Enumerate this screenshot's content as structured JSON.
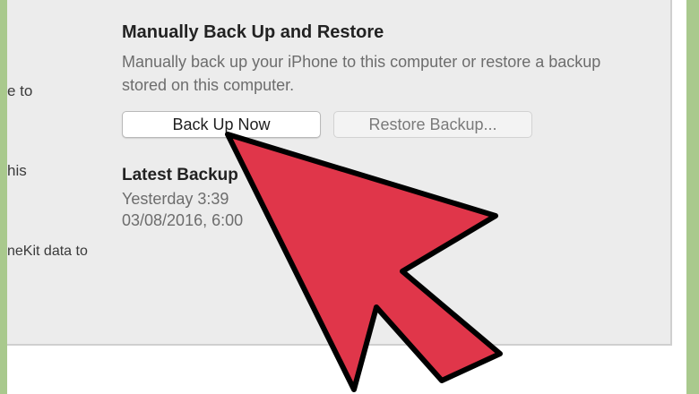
{
  "left_column": {
    "line1": "e to",
    "line2": "his",
    "line3": "neKit data to"
  },
  "backup_section": {
    "title": "Manually Back Up and Restore",
    "description": "Manually back up your iPhone to this computer or restore a backup stored on this computer.",
    "back_up_now_label": "Back Up Now",
    "restore_backup_label": "Restore Backup..."
  },
  "latest_backups": {
    "title": "Latest Backup",
    "line1": "Yesterday 3:39",
    "line2": "03/08/2016, 6:00"
  },
  "colors": {
    "arrow_fill": "#e0364a",
    "arrow_stroke": "#000000",
    "frame": "#a9c98d",
    "panel_bg": "#ececec"
  },
  "icons": {
    "pointer": "pointing-arrow-icon"
  }
}
